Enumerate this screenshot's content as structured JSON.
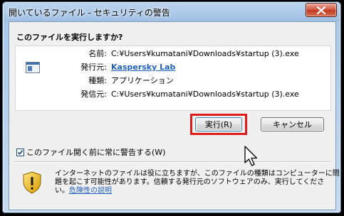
{
  "window": {
    "title": "開いているファイル - セキュリティの警告"
  },
  "question": "このファイルを実行しますか?",
  "file_info": [
    {
      "label": "名前:",
      "value": "C:¥Users¥kumatani¥Downloads¥startup (3).exe"
    },
    {
      "label": "発行元:",
      "value": "Kaspersky Lab"
    },
    {
      "label": "種類:",
      "value": "アプリケーション"
    },
    {
      "label": "発信元:",
      "value": "C:¥Users¥kumatani¥Downloads¥startup (3).exe"
    }
  ],
  "buttons": {
    "run": "実行(R)",
    "cancel": "キャンセル"
  },
  "checkbox": {
    "label": "このファイル開く前に常に警告する(W)",
    "checked": true
  },
  "warning": {
    "line1": "インターネットのファイルは役に立ちますが、このファイルの種類はコンピューターに問",
    "line2": "題を起こす可能性があります。信頼する発行元のソフトウェアのみ、実行してくださ",
    "line3_prefix": "い。",
    "link": "危険性の説明"
  },
  "colors": {
    "highlight": "#e01b1b",
    "link": "#1f5fbf"
  }
}
